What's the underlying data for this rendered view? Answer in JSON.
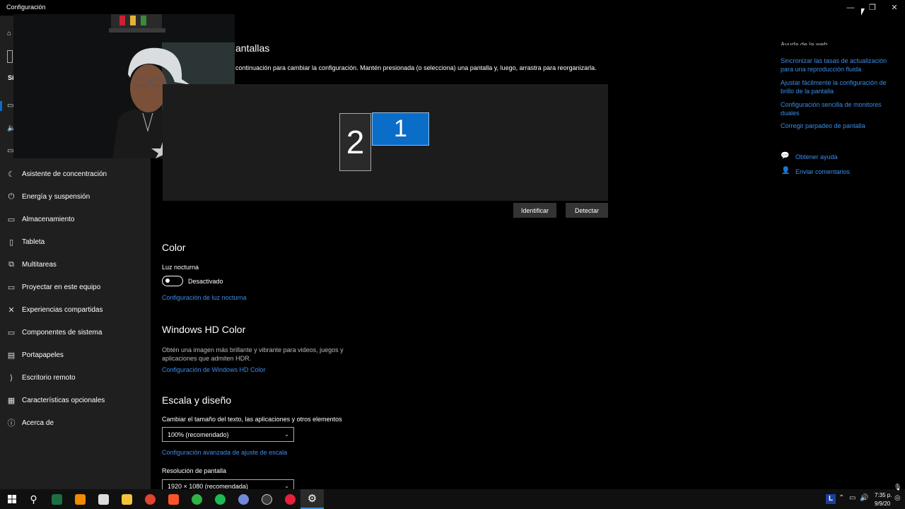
{
  "window": {
    "title": "Configuración",
    "minimize_glyph": "—",
    "restore_glyph": "❐",
    "close_glyph": "✕"
  },
  "sidebar": {
    "partial_label": "Si",
    "items": [
      {
        "label": "Asistente de concentración",
        "icon": "moon-icon",
        "glyph": "☾"
      },
      {
        "label": "Energía y suspensión",
        "icon": "power-icon",
        "glyph": "⏻"
      },
      {
        "label": "Almacenamiento",
        "icon": "storage-icon",
        "glyph": "▭"
      },
      {
        "label": "Tableta",
        "icon": "tablet-icon",
        "glyph": "▯"
      },
      {
        "label": "Multitareas",
        "icon": "multitask-icon",
        "glyph": "⧉"
      },
      {
        "label": "Proyectar en este equipo",
        "icon": "project-icon",
        "glyph": "▭"
      },
      {
        "label": "Experiencias compartidas",
        "icon": "shared-icon",
        "glyph": "✕"
      },
      {
        "label": "Componentes de sistema",
        "icon": "components-icon",
        "glyph": "▭"
      },
      {
        "label": "Portapapeles",
        "icon": "clipboard-icon",
        "glyph": "▤"
      },
      {
        "label": "Escritorio remoto",
        "icon": "remote-icon",
        "glyph": "⟩"
      },
      {
        "label": "Características opcionales",
        "icon": "optional-icon",
        "glyph": "▦"
      },
      {
        "label": "Acerca de",
        "icon": "info-icon",
        "glyph": "ⓘ"
      }
    ]
  },
  "display": {
    "heading_partial": "antallas",
    "instructions": "continuación para cambiar la configuración. Mantén presionada (o selecciona) una pantalla y, luego, arrastra para reorganizarla.",
    "monitor_2_label": "2",
    "monitor_1_label": "1",
    "identify_label": "Identificar",
    "detect_label": "Detectar"
  },
  "color": {
    "heading": "Color",
    "night_light_label": "Luz nocturna",
    "toggle_state": "Desactivado",
    "toggle_on": false,
    "night_light_settings_link": "Configuración de luz nocturna"
  },
  "hdr": {
    "heading": "Windows HD Color",
    "description_line1": "Obtén una imagen más brillante y vibrante para videos, juegos y",
    "description_line2": "aplicaciones que admiten HDR.",
    "settings_link": "Configuración de Windows HD Color"
  },
  "scale": {
    "heading": "Escala y diseño",
    "size_label": "Cambiar el tamaño del texto, las aplicaciones y otros elementos",
    "size_value": "100% (recomendado)",
    "advanced_link": "Configuración avanzada de ajuste de escala",
    "resolution_label": "Resolución de pantalla",
    "resolution_value": "1920 × 1080 (recomendada)"
  },
  "help": {
    "heading_partial": "Ayuda de la web",
    "links": [
      {
        "line1": "Sincronizar las tasas de actualización",
        "line2": "para una reproducción fluida"
      },
      {
        "line1": "Ajustar fácilmente la configuración de",
        "line2": "brillo de la pantalla"
      },
      {
        "line1": "Configuración sencilla de monitores",
        "line2": "duales"
      },
      {
        "line1": "Corregir parpadeo de pantalla",
        "line2": ""
      }
    ],
    "get_help": "Obtener ayuda",
    "feedback": "Enviar comentarios"
  },
  "taskbar": {
    "apps": [
      {
        "name": "chrome",
        "color": "#e0442f"
      },
      {
        "name": "brave",
        "color": "#fb542b"
      },
      {
        "name": "green-app",
        "color": "#2fb344"
      },
      {
        "name": "spotify",
        "color": "#1db954"
      },
      {
        "name": "discord",
        "color": "#7289da"
      },
      {
        "name": "obs",
        "color": "#3b3b3b"
      },
      {
        "name": "opera",
        "color": "#e6203c"
      }
    ],
    "lang": "L",
    "time": "7:35 p.",
    "date": "9/9/20"
  },
  "colors": {
    "accent": "#0a6dc8",
    "link": "#3b8ee8",
    "sidebar_bg": "#1f1f1f"
  }
}
